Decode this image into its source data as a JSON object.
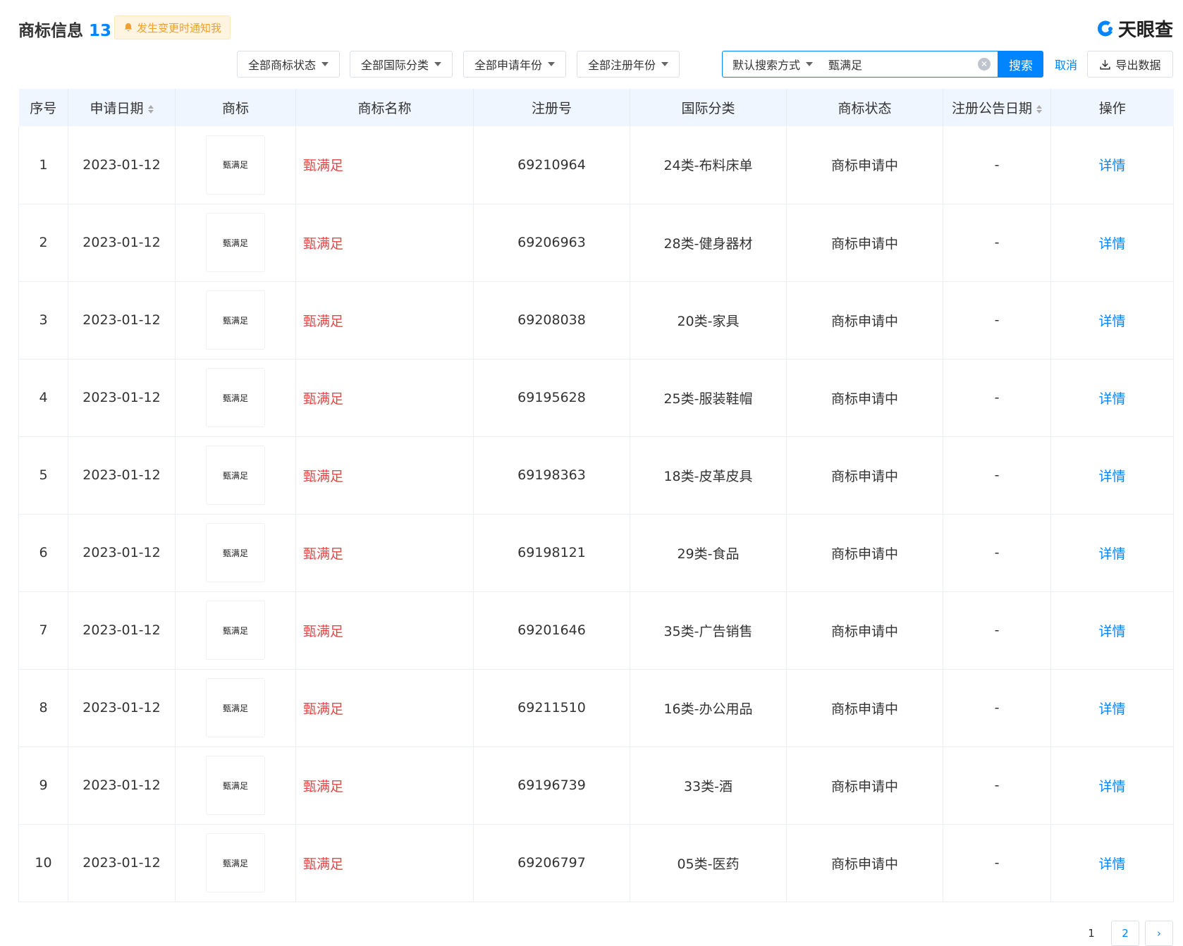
{
  "header": {
    "title": "商标信息",
    "count": "13",
    "notify_label": "发生变更时通知我",
    "brand": "天眼查"
  },
  "filters": {
    "status": "全部商标状态",
    "intl_class": "全部国际分类",
    "apply_year": "全部申请年份",
    "reg_year": "全部注册年份",
    "search_mode": "默认搜索方式",
    "search_value": "甄满足",
    "search_button": "搜索",
    "cancel": "取消",
    "export": "导出数据"
  },
  "table": {
    "columns": [
      "序号",
      "申请日期",
      "商标",
      "商标名称",
      "注册号",
      "国际分类",
      "商标状态",
      "注册公告日期",
      "操作"
    ],
    "rows": [
      {
        "no": "1",
        "date": "2023-01-12",
        "logo": "甄满足",
        "name": "甄满足",
        "reg_no": "69210964",
        "class": "24类-布料床单",
        "status": "商标申请中",
        "pub_date": "-",
        "op": "详情"
      },
      {
        "no": "2",
        "date": "2023-01-12",
        "logo": "甄满足",
        "name": "甄满足",
        "reg_no": "69206963",
        "class": "28类-健身器材",
        "status": "商标申请中",
        "pub_date": "-",
        "op": "详情"
      },
      {
        "no": "3",
        "date": "2023-01-12",
        "logo": "甄满足",
        "name": "甄满足",
        "reg_no": "69208038",
        "class": "20类-家具",
        "status": "商标申请中",
        "pub_date": "-",
        "op": "详情"
      },
      {
        "no": "4",
        "date": "2023-01-12",
        "logo": "甄满足",
        "name": "甄满足",
        "reg_no": "69195628",
        "class": "25类-服装鞋帽",
        "status": "商标申请中",
        "pub_date": "-",
        "op": "详情"
      },
      {
        "no": "5",
        "date": "2023-01-12",
        "logo": "甄满足",
        "name": "甄满足",
        "reg_no": "69198363",
        "class": "18类-皮革皮具",
        "status": "商标申请中",
        "pub_date": "-",
        "op": "详情"
      },
      {
        "no": "6",
        "date": "2023-01-12",
        "logo": "甄满足",
        "name": "甄满足",
        "reg_no": "69198121",
        "class": "29类-食品",
        "status": "商标申请中",
        "pub_date": "-",
        "op": "详情"
      },
      {
        "no": "7",
        "date": "2023-01-12",
        "logo": "甄满足",
        "name": "甄满足",
        "reg_no": "69201646",
        "class": "35类-广告销售",
        "status": "商标申请中",
        "pub_date": "-",
        "op": "详情"
      },
      {
        "no": "8",
        "date": "2023-01-12",
        "logo": "甄满足",
        "name": "甄满足",
        "reg_no": "69211510",
        "class": "16类-办公用品",
        "status": "商标申请中",
        "pub_date": "-",
        "op": "详情"
      },
      {
        "no": "9",
        "date": "2023-01-12",
        "logo": "甄满足",
        "name": "甄满足",
        "reg_no": "69196739",
        "class": "33类-酒",
        "status": "商标申请中",
        "pub_date": "-",
        "op": "详情"
      },
      {
        "no": "10",
        "date": "2023-01-12",
        "logo": "甄满足",
        "name": "甄满足",
        "reg_no": "69206797",
        "class": "05类-医药",
        "status": "商标申请中",
        "pub_date": "-",
        "op": "详情"
      }
    ]
  },
  "pagination": {
    "page1": "1",
    "page2": "2",
    "next": "›"
  },
  "icons": {
    "notify": "bell-icon",
    "brand": "tianyancha-logo-icon",
    "export": "download-icon",
    "clear": "clear-icon",
    "sort": "sort-icon"
  },
  "colors": {
    "accent": "#0084ff",
    "trademark_name": "#e64545",
    "notify_text": "#f0a030"
  }
}
